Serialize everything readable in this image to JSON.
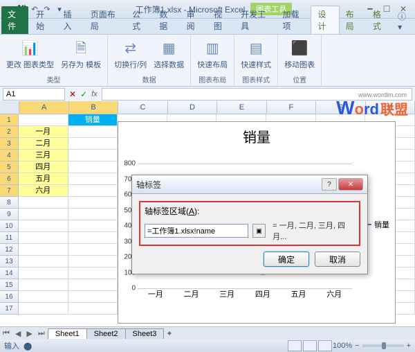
{
  "app": {
    "title": "工作簿1.xlsx - Microsoft Excel",
    "context_tab": "图表工具"
  },
  "tabs": {
    "file": "文件",
    "home": "开始",
    "insert": "插入",
    "layout": "页面布局",
    "formulas": "公式",
    "data": "数据",
    "review": "审阅",
    "view": "视图",
    "developer": "开发工具",
    "addins": "加载项",
    "design": "设计",
    "layout2": "布局",
    "format": "格式"
  },
  "ribbon": {
    "g1": {
      "b1": "更改\n图表类型",
      "b2": "另存为\n模板",
      "label": "类型"
    },
    "g2": {
      "b1": "切换行/列",
      "b2": "选择数据",
      "label": "数据"
    },
    "g3": {
      "b1": "快速布局",
      "label": "图表布局"
    },
    "g4": {
      "b1": "快速样式",
      "label": "图表样式"
    },
    "g5": {
      "b1": "移动图表",
      "label": "位置"
    }
  },
  "namebox": "A1",
  "columns": [
    "A",
    "B",
    "C",
    "D",
    "E",
    "F",
    "G",
    "H"
  ],
  "data_a": [
    "一月",
    "二月",
    "三月",
    "四月",
    "五月",
    "六月"
  ],
  "hdr_b": "销量",
  "chart": {
    "title": "销量",
    "legend": "销量",
    "xticks": [
      "一月",
      "二月",
      "三月",
      "四月",
      "五月",
      "六月"
    ],
    "yticks": [
      "0",
      "100",
      "200",
      "300",
      "400",
      "500",
      "600",
      "700",
      "800"
    ]
  },
  "chart_data": {
    "type": "line",
    "title": "销量",
    "categories": [
      "一月",
      "二月",
      "三月",
      "四月",
      "五月",
      "六月"
    ],
    "series": [
      {
        "name": "销量",
        "values": [
          700,
          200,
          600,
          100,
          500,
          400
        ]
      }
    ],
    "ylim": [
      0,
      800
    ],
    "xlabel": "",
    "ylabel": ""
  },
  "dialog": {
    "title": "轴标签",
    "label_pre": "轴标签区域(",
    "label_u": "A",
    "label_post": "):",
    "input": "=工作簿1.xlsx!name",
    "preview": "= 一月, 二月, 三月, 四月...",
    "ok": "确定",
    "cancel": "取消"
  },
  "sheets": {
    "s1": "Sheet1",
    "s2": "Sheet2",
    "s3": "Sheet3"
  },
  "status": {
    "mode": "输入",
    "zoom": "100%"
  },
  "watermark": {
    "url": "www.wordlm.com",
    "w": "W",
    "o": "o",
    "rd": "rd",
    "cn": "联盟"
  }
}
